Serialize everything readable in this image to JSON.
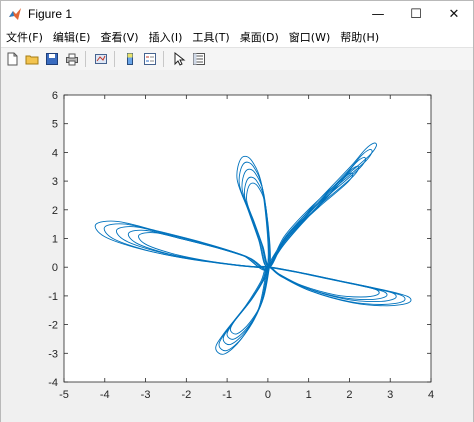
{
  "window": {
    "title": "Figure 1",
    "controls": [
      "—",
      "☐",
      "✕"
    ]
  },
  "menu": {
    "items": [
      "文件(F)",
      "编辑(E)",
      "查看(V)",
      "插入(I)",
      "工具(T)",
      "桌面(D)",
      "窗口(W)",
      "帮助(H)"
    ]
  },
  "toolbar": {
    "icons": [
      "new-figure-icon",
      "open-file-icon",
      "save-icon",
      "print-icon",
      "link-plot-icon",
      "insert-colorbar-icon",
      "insert-legend-icon",
      "pointer-icon",
      "property-inspector-icon"
    ]
  },
  "colors": {
    "line": "#0072bd",
    "axes": "#262626",
    "plot_bg": "#ffffff",
    "figure_bg": "#f0f0f0"
  },
  "chart_data": {
    "type": "line",
    "title": "",
    "xlabel": "",
    "ylabel": "",
    "xlim": [
      -5,
      4
    ],
    "ylim": [
      -4,
      6
    ],
    "xticks": [
      -5,
      -4,
      -3,
      -2,
      -1,
      0,
      1,
      2,
      3,
      4
    ],
    "yticks": [
      -4,
      -3,
      -2,
      -1,
      0,
      1,
      2,
      3,
      4,
      5,
      6
    ],
    "grid": false,
    "series": [
      {
        "description_shape": "four-lobed rose curve with small inner loop",
        "lobes": [
          {
            "direction": "upper-right",
            "max_point": [
              2.6,
              4.3
            ]
          },
          {
            "direction": "upper-left",
            "max_point": [
              -0.5,
              3.9
            ]
          },
          {
            "direction": "left",
            "max_point": [
              -4.1,
              1.7
            ]
          },
          {
            "direction": "lower-right",
            "max_point": [
              3.45,
              -1.1
            ]
          },
          {
            "direction": "lower-left",
            "max_point": [
              -1.0,
              -3.0
            ]
          }
        ],
        "x": [
          0,
          0.4,
          1.0,
          1.6,
          2.0,
          2.3,
          2.5,
          2.55,
          2.4,
          2.0,
          1.5,
          0.9,
          0.4,
          0,
          -0.2,
          -0.45,
          -0.7,
          -0.6,
          -0.35,
          -0.1,
          0,
          -0.6,
          -1.5,
          -2.6,
          -3.5,
          -4.0,
          -3.8,
          -3.0,
          -2.0,
          -1.0,
          -0.3,
          0,
          0.8,
          1.8,
          2.8,
          3.3,
          3.3,
          2.8,
          2.0,
          1.0,
          0.3,
          0,
          -0.15,
          -0.5,
          -1.0,
          -1.2,
          -1.0,
          -0.6,
          -0.2,
          0
        ],
        "y": [
          0,
          0.9,
          1.9,
          2.8,
          3.4,
          3.9,
          4.1,
          4.0,
          3.7,
          3.2,
          2.6,
          1.8,
          1.0,
          0,
          0.9,
          1.9,
          2.9,
          3.6,
          3.5,
          2.5,
          0,
          0.4,
          0.8,
          1.2,
          1.5,
          1.4,
          1.0,
          0.6,
          0.3,
          0.1,
          0,
          0,
          -0.2,
          -0.5,
          -0.8,
          -1.0,
          -1.2,
          -1.3,
          -1.2,
          -0.8,
          -0.3,
          0,
          -0.5,
          -1.3,
          -2.2,
          -2.7,
          -2.9,
          -2.4,
          -1.4,
          0
        ]
      }
    ]
  }
}
